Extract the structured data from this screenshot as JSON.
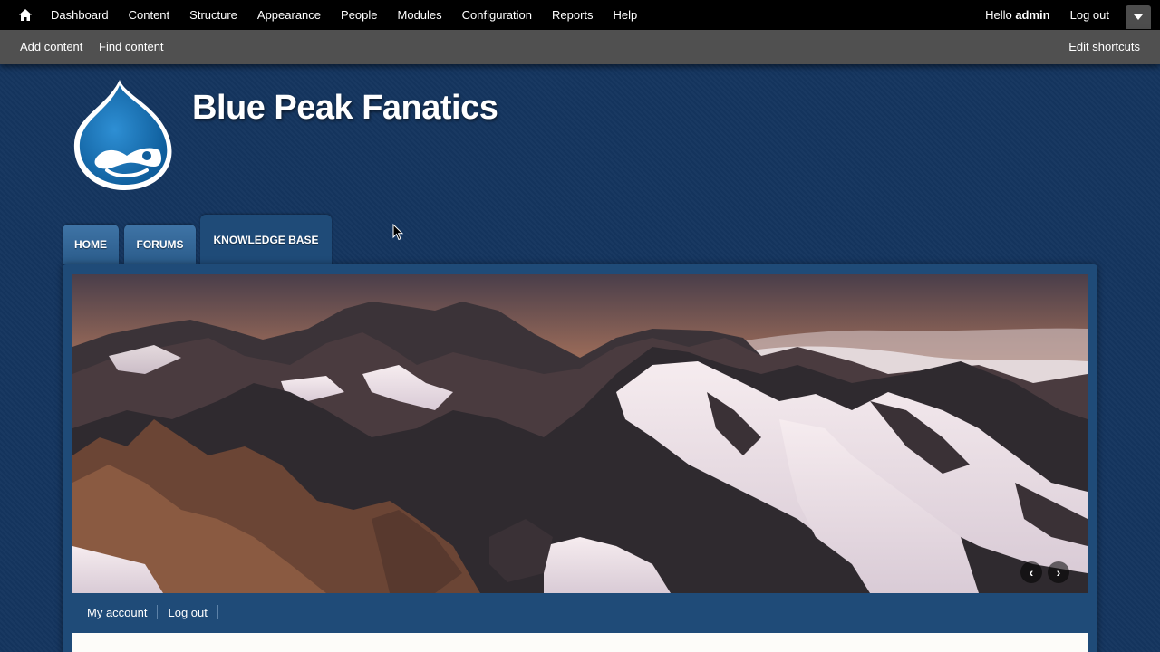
{
  "toolbar": {
    "home_icon": "home-icon",
    "menu": [
      "Dashboard",
      "Content",
      "Structure",
      "Appearance",
      "People",
      "Modules",
      "Configuration",
      "Reports",
      "Help"
    ],
    "hello_prefix": "Hello",
    "username": "admin",
    "logout": "Log out"
  },
  "shortcuts": {
    "add_content": "Add content",
    "find_content": "Find content",
    "edit_shortcuts": "Edit shortcuts"
  },
  "site": {
    "name": "Blue Peak Fanatics",
    "logo_icon": "drupal-drop-logo"
  },
  "tabs": [
    {
      "label": "HOME",
      "active": false
    },
    {
      "label": "FORUMS",
      "active": false
    },
    {
      "label": "KNOWLEDGE BASE",
      "active": true
    }
  ],
  "slider": {
    "prev": "‹",
    "next": "›"
  },
  "secondary": {
    "my_account": "My account",
    "log_out": "Log out"
  },
  "colors": {
    "background": "#14355f",
    "frame": "#1f4b78",
    "toolbar": "#000000",
    "shortcuts_bar": "#505050",
    "tab": "#2f6496"
  }
}
